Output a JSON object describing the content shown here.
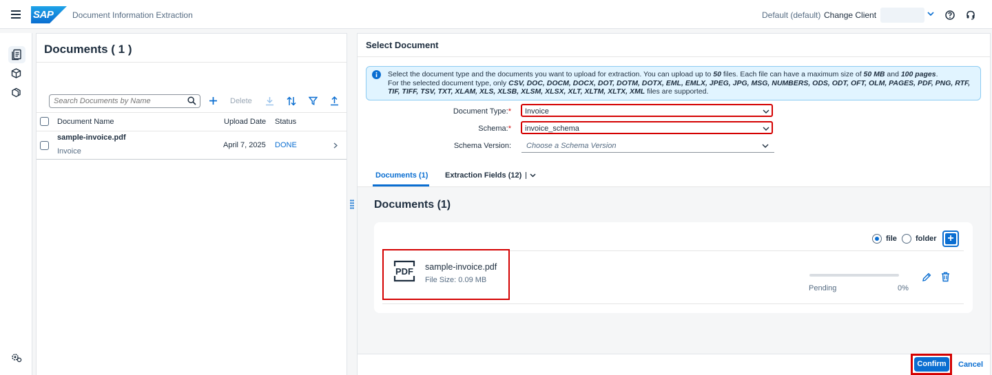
{
  "shell": {
    "logo_text": "SAP",
    "app_title": "Document Information Extraction",
    "client_label": "Default (default)",
    "change_client": "Change Client"
  },
  "sidenav": {
    "items": [
      {
        "icon": "document-list-icon",
        "selected": true
      },
      {
        "icon": "cube-icon",
        "selected": false
      },
      {
        "icon": "cubes-icon",
        "selected": false
      }
    ],
    "bottom_icon": "settings-icon"
  },
  "left": {
    "title": "Documents ( 1 )",
    "search_placeholder": "Search Documents by Name",
    "toolbar": {
      "add_icon": "add-icon",
      "delete_label": "Delete",
      "download_icon": "download-icon",
      "sort_icon": "sort-icon",
      "filter_icon": "filter-icon",
      "upload_icon": "upload-icon"
    },
    "columns": [
      "Document Name",
      "Upload Date",
      "Status"
    ],
    "rows": [
      {
        "name": "sample-invoice.pdf",
        "type": "Invoice",
        "date": "April 7, 2025",
        "status": "DONE"
      }
    ]
  },
  "right": {
    "title": "Select Document",
    "info": {
      "line1_a": "Select the document type and the documents you want to upload for extraction. You can upload up to ",
      "max_files": "50",
      "line1_b": " files. Each file can have a maximum size of ",
      "max_size": "50 MB",
      "line1_c": " and ",
      "max_pages": "100 pages",
      "line1_d": ".",
      "line2_a": "For the selected document type, only ",
      "formats": "CSV, DOC, DOCM, DOCX, DOT, DOTM, DOTX, EML, EMLX, JPEG, JPG, MSG, NUMBERS, ODS, ODT, OFT, OLM, PAGES, PDF, PNG, RTF, TIF, TIFF, TSV, TXT, XLAM, XLS, XLSB, XLSM, XLSX, XLT, XLTM, XLTX, XML",
      "line2_b": " files are supported."
    },
    "form": {
      "doc_type_label": "Document Type:",
      "doc_type_value": "Invoice",
      "schema_label": "Schema:",
      "schema_value": "invoice_schema",
      "schema_version_label": "Schema Version:",
      "schema_version_placeholder": "Choose a Schema Version",
      "required_mark": "*"
    },
    "tabs": [
      {
        "label": "Documents (1)",
        "selected": true
      },
      {
        "label": "Extraction Fields (12)",
        "selected": false
      }
    ],
    "documents_heading": "Documents (1)",
    "upload": {
      "mode_file": "file",
      "mode_folder": "folder",
      "selected_mode": "file",
      "file_name": "sample-invoice.pdf",
      "file_size": "File Size: 0.09 MB",
      "pdf_badge": "PDF",
      "status": "Pending",
      "percent_label": "0%",
      "progress": 0.0
    },
    "footer": {
      "confirm": "Confirm",
      "cancel": "Cancel"
    }
  },
  "colors": {
    "accent": "#0a6ed1",
    "highlight": "#d40000",
    "info_bg": "#e1f4ff"
  }
}
